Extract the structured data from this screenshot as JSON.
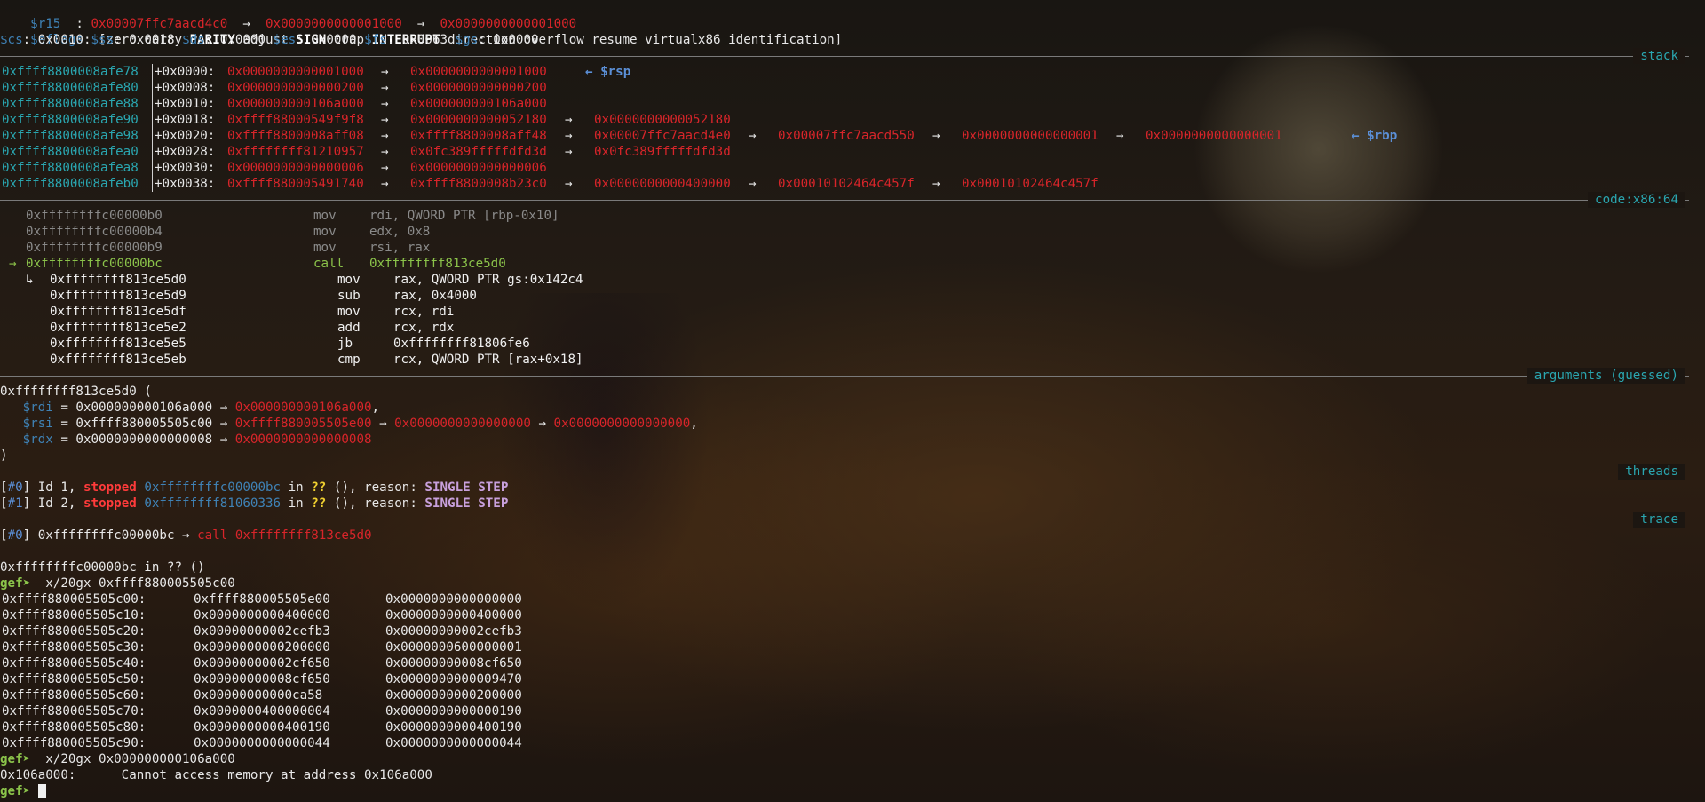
{
  "registers": {
    "r15": {
      "name": "$r15",
      "sep": "  : ",
      "chain": [
        "0x00007ffc7aacd4c0",
        "0x0000000000001000",
        "0x0000000000001000"
      ]
    },
    "eflags": {
      "name": "$eflags",
      "parts": [
        {
          "t": "zero",
          "b": false
        },
        {
          "t": "carry",
          "b": false
        },
        {
          "t": "PARITY",
          "b": true
        },
        {
          "t": "adjust",
          "b": false
        },
        {
          "t": "SIGN",
          "b": true
        },
        {
          "t": "trap",
          "b": false
        },
        {
          "t": "INTERRUPT",
          "b": true
        },
        {
          "t": "direction",
          "b": false
        },
        {
          "t": "overflow",
          "b": false
        },
        {
          "t": "resume",
          "b": false
        },
        {
          "t": "virtualx86",
          "b": false
        },
        {
          "t": "identification",
          "b": false
        }
      ]
    },
    "segments": [
      {
        "n": "$cs",
        "v": "0x0010"
      },
      {
        "n": "$ss",
        "v": "0x0018"
      },
      {
        "n": "$ds",
        "v": "0x0000"
      },
      {
        "n": "$es",
        "v": "0x0000"
      },
      {
        "n": "$fs",
        "v": "0x0063"
      },
      {
        "n": "$gs",
        "v": "0x0000"
      }
    ]
  },
  "sections": {
    "stack": "stack",
    "code": "code:x86:64",
    "arguments": "arguments (guessed)",
    "threads": "threads",
    "trace": "trace"
  },
  "stack": [
    {
      "addr": "0xffff8800008afe78",
      "off": "+0x0000",
      "chain": [
        "0x0000000000001000",
        "0x0000000000001000"
      ],
      "tag": "← $rsp"
    },
    {
      "addr": "0xffff8800008afe80",
      "off": "+0x0008",
      "chain": [
        "0x0000000000000200",
        "0x0000000000000200"
      ],
      "tag": ""
    },
    {
      "addr": "0xffff8800008afe88",
      "off": "+0x0010",
      "chain": [
        "0x000000000106a000",
        "0x000000000106a000"
      ],
      "tag": ""
    },
    {
      "addr": "0xffff8800008afe90",
      "off": "+0x0018",
      "chain": [
        "0xffff88000549f9f8",
        "0x0000000000052180",
        "0x0000000000052180"
      ],
      "tag": ""
    },
    {
      "addr": "0xffff8800008afe98",
      "off": "+0x0020",
      "chain": [
        "0xffff8800008aff08",
        "0xffff8800008aff48",
        "0x00007ffc7aacd4e0",
        "0x00007ffc7aacd550",
        "0x0000000000000001",
        "0x0000000000000001"
      ],
      "tag": "← $rbp"
    },
    {
      "addr": "0xffff8800008afea0",
      "off": "+0x0028",
      "chain": [
        "0xffffffff81210957",
        "0x0fc389fffffdfd3d",
        "0x0fc389fffffdfd3d"
      ],
      "tag": ""
    },
    {
      "addr": "0xffff8800008afea8",
      "off": "+0x0030",
      "chain": [
        "0x0000000000000006",
        "0x0000000000000006"
      ],
      "tag": ""
    },
    {
      "addr": "0xffff8800008afeb0",
      "off": "+0x0038",
      "chain": [
        "0xffff880005491740",
        "0xffff8800008b23c0",
        "0x0000000000400000",
        "0x00010102464c457f",
        "0x00010102464c457f"
      ],
      "tag": ""
    }
  ],
  "code": {
    "prior": [
      {
        "addr": "0xffffffffc00000b0",
        "mn": "mov",
        "op": "rdi, QWORD PTR [rbp-0x10]"
      },
      {
        "addr": "0xffffffffc00000b4",
        "mn": "mov",
        "op": "edx, 0x8"
      },
      {
        "addr": "0xffffffffc00000b9",
        "mn": "mov",
        "op": "rsi, rax"
      }
    ],
    "current": {
      "marker": "→",
      "addr": "0xffffffffc00000bc",
      "mn": "call",
      "op": "0xffffffff813ce5d0"
    },
    "target": [
      {
        "prefix": "↳",
        "addr": "0xffffffff813ce5d0",
        "mn": "mov",
        "op": "rax, QWORD PTR gs:0x142c4"
      },
      {
        "prefix": "",
        "addr": "0xffffffff813ce5d9",
        "mn": "sub",
        "op": "rax, 0x4000"
      },
      {
        "prefix": "",
        "addr": "0xffffffff813ce5df",
        "mn": "mov",
        "op": "rcx, rdi"
      },
      {
        "prefix": "",
        "addr": "0xffffffff813ce5e2",
        "mn": "add",
        "op": "rcx, rdx"
      },
      {
        "prefix": "",
        "addr": "0xffffffff813ce5e5",
        "mn": "jb",
        "op": "0xffffffff81806fe6"
      },
      {
        "prefix": "",
        "addr": "0xffffffff813ce5eb",
        "mn": "cmp",
        "op": "rcx, QWORD PTR [rax+0x18]"
      }
    ]
  },
  "arguments": {
    "func": "0xffffffff813ce5d0 (",
    "args": [
      {
        "reg": "$rdi",
        "val": "0x000000000106a000",
        "chain": [
          "0x000000000106a000"
        ],
        "end": ","
      },
      {
        "reg": "$rsi",
        "val": "0xffff880005505c00",
        "chain": [
          "0xffff880005505e00",
          "0x0000000000000000",
          "0x0000000000000000"
        ],
        "end": ","
      },
      {
        "reg": "$rdx",
        "val": "0x0000000000000008",
        "chain": [
          "0x0000000000000008"
        ],
        "end": ""
      }
    ],
    "close": ")"
  },
  "threads": [
    {
      "idx": "#0",
      "id": "Id 1,",
      "state": "stopped",
      "addr": "0xffffffffc00000bc",
      "in": "in",
      "fn": "??",
      "rest": "(), reason:",
      "reason": "SINGLE STEP"
    },
    {
      "idx": "#1",
      "id": "Id 2,",
      "state": "stopped",
      "addr": "0xffffffff81060336",
      "in": "in",
      "fn": "??",
      "rest": "(), reason:",
      "reason": "SINGLE STEP"
    }
  ],
  "trace": [
    {
      "idx": "#0",
      "addr": "0xffffffffc00000bc",
      "arrow": "→",
      "call": "call",
      "target": "0xffffffff813ce5d0"
    }
  ],
  "console": {
    "location": "0xffffffffc00000bc in ?? ()",
    "prompt": "gef➤",
    "cmd1": "x/20gx 0xffff880005505c00",
    "dump": [
      [
        "0xffff880005505c00:",
        "0xffff880005505e00",
        "0x0000000000000000"
      ],
      [
        "0xffff880005505c10:",
        "0x0000000000400000",
        "0x0000000000400000"
      ],
      [
        "0xffff880005505c20:",
        "0x00000000002cefb3",
        "0x00000000002cefb3"
      ],
      [
        "0xffff880005505c30:",
        "0x0000000000200000",
        "0x0000000600000001"
      ],
      [
        "0xffff880005505c40:",
        "0x00000000002cf650",
        "0x00000000008cf650"
      ],
      [
        "0xffff880005505c50:",
        "0x00000000008cf650",
        "0x0000000000009470"
      ],
      [
        "0xffff880005505c60:",
        "0x00000000000ca58",
        "0x0000000000200000"
      ],
      [
        "0xffff880005505c70:",
        "0x0000000400000004",
        "0x0000000000000190"
      ],
      [
        "0xffff880005505c80:",
        "0x0000000000400190",
        "0x0000000000400190"
      ],
      [
        "0xffff880005505c90:",
        "0x0000000000000044",
        "0x0000000000000044"
      ]
    ],
    "cmd2": "x/20gx 0x000000000106a000",
    "error_addr": "0x106a000:",
    "error_msg": "Cannot access memory at address 0x106a000"
  }
}
